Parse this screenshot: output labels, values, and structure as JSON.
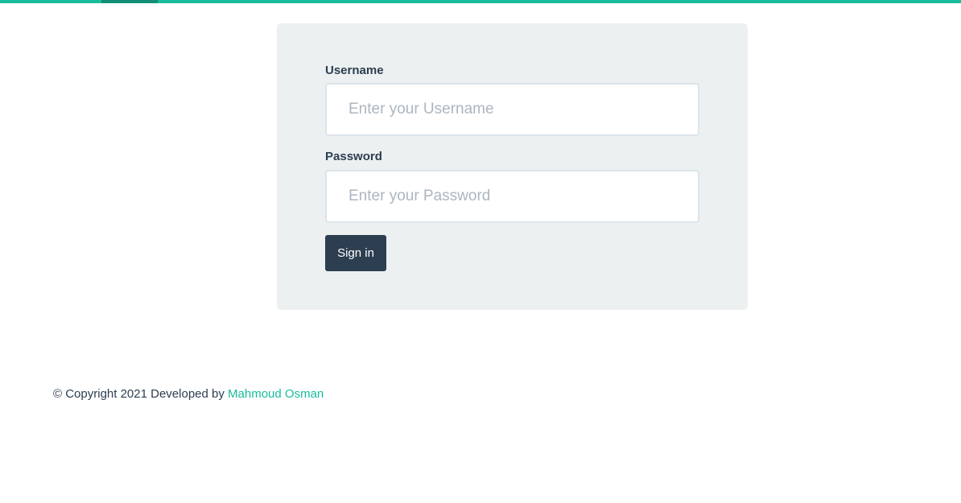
{
  "colors": {
    "accent": "#18bc9c",
    "primary": "#2c3e50",
    "card_background": "#ecf0f1"
  },
  "login_form": {
    "username_label": "Username",
    "username_placeholder": "Enter your Username",
    "username_value": "",
    "password_label": "Password",
    "password_placeholder": "Enter your Password",
    "password_value": "",
    "signin_label": "Sign in"
  },
  "footer": {
    "copyright_text": "© Copyright 2021 Developed by",
    "author_link": "Mahmoud Osman"
  }
}
